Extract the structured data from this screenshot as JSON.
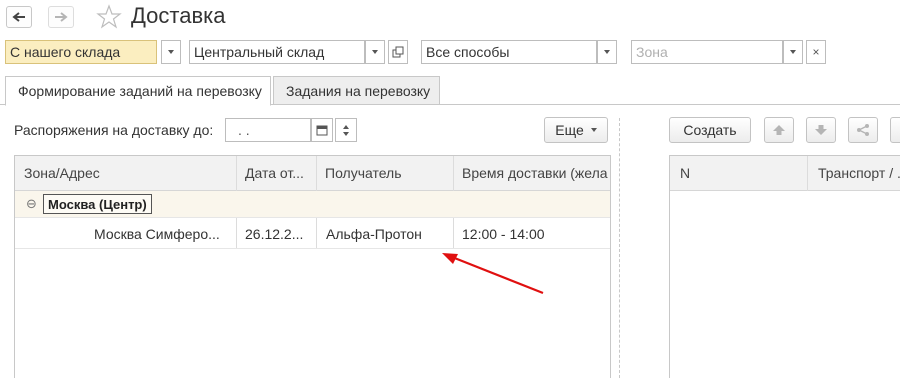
{
  "window": {
    "title": "Доставка"
  },
  "filters": {
    "source": "С нашего склада",
    "warehouse": "Центральный склад",
    "method": "Все способы",
    "zone_placeholder": "Зона"
  },
  "tabs": [
    {
      "label": "Формирование заданий на перевозку",
      "active": true
    },
    {
      "label": "Задания на перевозку",
      "active": false
    }
  ],
  "left_panel": {
    "date_label": "Распоряжения на доставку до:",
    "date_value": ". .",
    "more_button": "Еще",
    "columns": [
      "Зона/Адрес",
      "Дата от...",
      "Получатель",
      "Время доставки (жела"
    ],
    "group": {
      "label": "Москва (Центр)",
      "toggle": "⊖"
    },
    "rows": [
      {
        "address": "Москва Симферо...",
        "date": "26.12.2...",
        "recipient": "Альфа-Протон",
        "time": "12:00 - 14:00"
      }
    ]
  },
  "right_panel": {
    "create_button": "Создать",
    "columns": [
      "N",
      "Транспорт / ..."
    ]
  },
  "colors": {
    "accent_field": "#fbeec0",
    "annotation_arrow": "#e01010"
  }
}
